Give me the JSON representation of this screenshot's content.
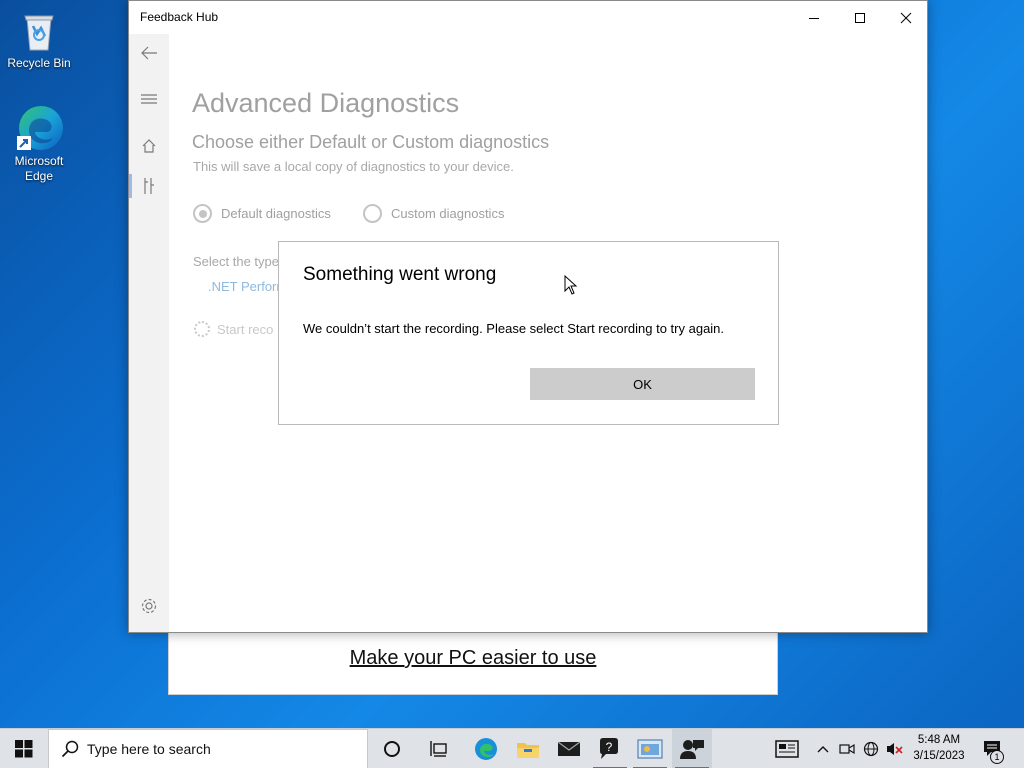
{
  "desktop": {
    "icons": [
      {
        "label": "Recycle Bin",
        "icon": "recycle-bin-icon"
      },
      {
        "label_line1": "Microsoft",
        "label_line2": "Edge",
        "icon": "edge-icon"
      }
    ]
  },
  "background_window": {
    "link_text": "Make your PC easier to use"
  },
  "app": {
    "title": "Feedback Hub",
    "page_title": "Advanced Diagnostics",
    "subtitle": "Choose either Default or Custom diagnostics",
    "description": "This will save a local copy of diagnostics to your device.",
    "radio_options": [
      {
        "label": "Default diagnostics",
        "selected": true
      },
      {
        "label": "Custom diagnostics",
        "selected": false
      }
    ],
    "select_label": "Select the type",
    "select_item": ".NET Perform",
    "start_recording": "Start reco"
  },
  "dialog": {
    "title": "Something went wrong",
    "message": "We couldn’t start the recording. Please select Start recording to try again.",
    "ok_label": "OK"
  },
  "taskbar": {
    "search_placeholder": "Type here to search",
    "time": "5:48 AM",
    "date": "3/15/2023",
    "notification_count": "1"
  },
  "colors": {
    "accent": "#0078d4",
    "desktop_blue": "#0b6fd1",
    "button_gray": "#cccccc"
  }
}
